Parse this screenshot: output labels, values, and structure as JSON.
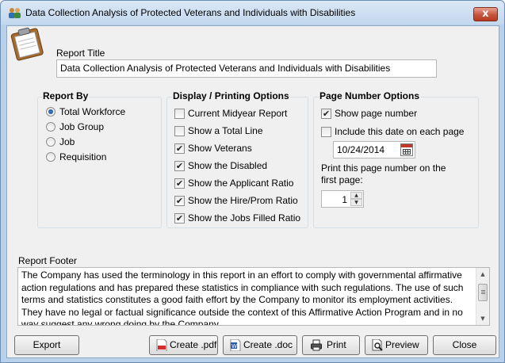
{
  "window": {
    "title": "Data Collection Analysis of Protected Veterans and Individuals with Disabilities",
    "close_label": "x",
    "icon": "app-people-icon"
  },
  "report_title": {
    "label": "Report Title",
    "value": "Data Collection Analysis of Protected Veterans and Individuals with Disabilities"
  },
  "report_by": {
    "title": "Report By",
    "options": [
      {
        "label": "Total Workforce",
        "selected": true
      },
      {
        "label": "Job Group",
        "selected": false
      },
      {
        "label": "Job",
        "selected": false
      },
      {
        "label": "Requisition",
        "selected": false
      }
    ]
  },
  "display": {
    "title": "Display / Printing Options",
    "options": [
      {
        "label": "Current Midyear Report",
        "checked": false
      },
      {
        "label": "Show a Total Line",
        "checked": false
      },
      {
        "label": "Show Veterans",
        "checked": true
      },
      {
        "label": "Show the Disabled",
        "checked": true
      },
      {
        "label": "Show the Applicant Ratio",
        "checked": true
      },
      {
        "label": "Show the Hire/Prom Ratio",
        "checked": true
      },
      {
        "label": "Show the Jobs Filled Ratio",
        "checked": true
      }
    ]
  },
  "page_number": {
    "title": "Page Number Options",
    "show_page_number": {
      "label": "Show page number",
      "checked": true
    },
    "include_date": {
      "label": "Include this date on each page",
      "checked": false
    },
    "date_value": "10/24/2014",
    "first_page_label_line1": "Print this page number on the",
    "first_page_label_line2": "first page:",
    "first_page_value": "1"
  },
  "footer": {
    "label": "Report Footer",
    "text": "The Company has used the terminology in this report in an effort to comply with governmental affirmative action regulations and has prepared these statistics in compliance with such regulations. The use of such terms and statistics constitutes a good faith effort by the Company to monitor its employment activities. They have no legal or factual significance outside the context of this Affirmative Action Program and in no way suggest any wrong doing by the Company."
  },
  "buttons": {
    "export": "Export",
    "create_pdf": "Create .pdf",
    "create_doc": "Create .doc",
    "print": "Print",
    "preview": "Preview",
    "close": "Close"
  },
  "colors": {
    "window_frame": "#b9d1ea",
    "client_bg": "#f0f0f0",
    "close_button": "#c7543c"
  }
}
